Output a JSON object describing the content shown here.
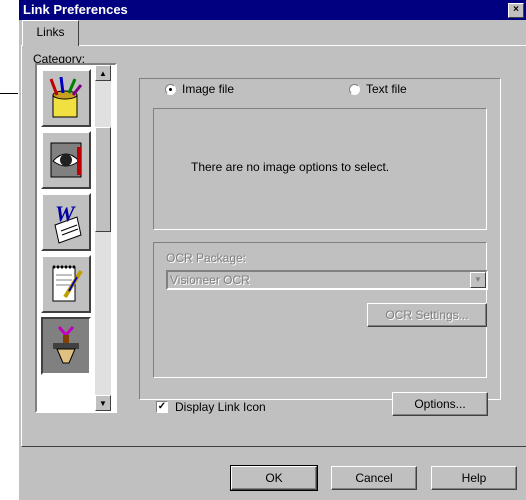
{
  "window": {
    "title": "Link Preferences",
    "close_glyph": "×"
  },
  "tabs": [
    {
      "label": "Links"
    }
  ],
  "category": {
    "label": "Category:",
    "items": [
      {
        "icon": "paint-cup-icon"
      },
      {
        "icon": "eye-icon"
      },
      {
        "icon": "word-document-icon"
      },
      {
        "icon": "notepad-pen-icon"
      },
      {
        "icon": "stamp-icon",
        "selected": true
      }
    ]
  },
  "file_type": {
    "image_file_label": "Image file",
    "text_file_label": "Text file",
    "selected": "image_file"
  },
  "image_options": {
    "message": "There are no image options to select."
  },
  "ocr": {
    "package_label": "OCR Package:",
    "package_value": "Visioneer OCR",
    "settings_label": "OCR Settings..."
  },
  "display_link_icon": {
    "label": "Display Link Icon",
    "checked": true,
    "check_glyph": "✓"
  },
  "buttons": {
    "options": "Options...",
    "ok": "OK",
    "cancel": "Cancel",
    "help": "Help"
  }
}
